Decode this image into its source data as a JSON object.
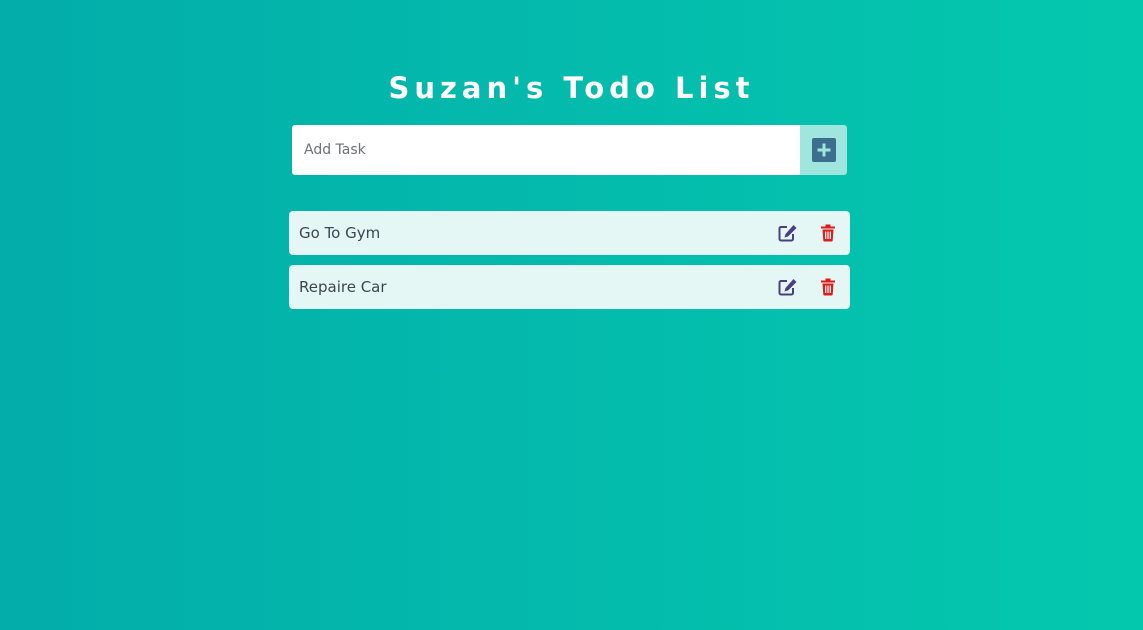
{
  "header": {
    "title": "Suzan's Todo List"
  },
  "add_task": {
    "placeholder": "Add Task",
    "value": "",
    "button_icon": "plus-square-icon"
  },
  "todos": [
    {
      "text": "Go To Gym",
      "edit_icon": "edit-icon",
      "delete_icon": "trash-icon"
    },
    {
      "text": "Repaire Car",
      "edit_icon": "edit-icon",
      "delete_icon": "trash-icon"
    }
  ],
  "colors": {
    "background_start": "#03adaa",
    "background_end": "#04c8ae",
    "add_button_bg": "#9fe6de",
    "add_icon": "#3c6e8d",
    "item_bg": "#e4f7f5",
    "edit_icon": "#4a3f86",
    "delete_icon": "#e01b1b"
  }
}
